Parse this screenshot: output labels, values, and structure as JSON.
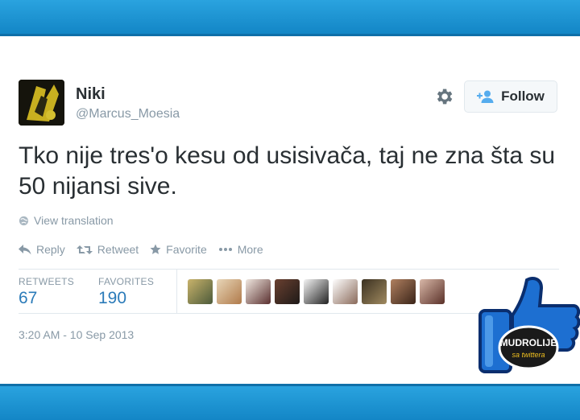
{
  "user": {
    "name": "Niki",
    "handle": "@Marcus_Moesia"
  },
  "follow_label": "Follow",
  "tweet_text": "Tko nije tres'o kesu od usisivača, taj ne zna šta su 50 nijansi sive.",
  "view_translation": "View translation",
  "actions": {
    "reply": "Reply",
    "retweet": "Retweet",
    "favorite": "Favorite",
    "more": "More"
  },
  "stats": {
    "retweets_label": "RETWEETS",
    "retweets": "67",
    "favorites_label": "FAVORITES",
    "favorites": "190"
  },
  "timestamp": "3:20 AM - 10 Sep 2013",
  "badge": {
    "line1": "MUDROLIJE",
    "line2": "sa twittera"
  },
  "colors": {
    "twitter_blue": "#1d8dd0",
    "link_blue": "#2b7bb9",
    "muted": "#8899a6",
    "text": "#292f33"
  }
}
